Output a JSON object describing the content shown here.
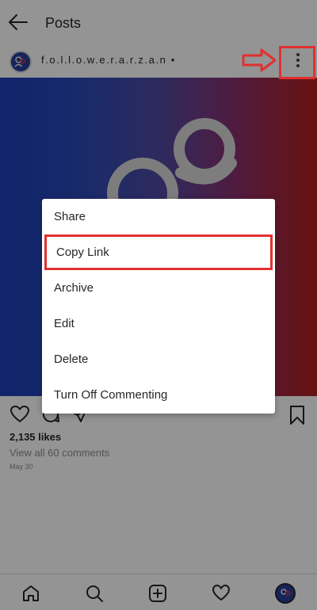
{
  "header": {
    "title": "Posts"
  },
  "post": {
    "username": "f.o.l.l.o.w.e.r.a.r.z.a.n •",
    "likes": "2,135 likes",
    "comments_link": "View all 60 comments",
    "date": "May 30"
  },
  "menu": {
    "items": [
      "Share",
      "Copy Link",
      "Archive",
      "Edit",
      "Delete",
      "Turn Off Commenting"
    ],
    "highlighted": "Copy Link"
  },
  "colors": {
    "annotation": "#e03131",
    "gradient_left": "#1f3fb8",
    "gradient_right": "#b3201c"
  },
  "icons": {
    "header": [
      "back-arrow-icon",
      "more-vertical-icon"
    ],
    "actions": [
      "heart-icon",
      "comment-icon",
      "share-icon",
      "bookmark-icon"
    ],
    "nav": [
      "home-icon",
      "search-icon",
      "add-post-icon",
      "activity-heart-icon",
      "profile-avatar-icon"
    ]
  }
}
